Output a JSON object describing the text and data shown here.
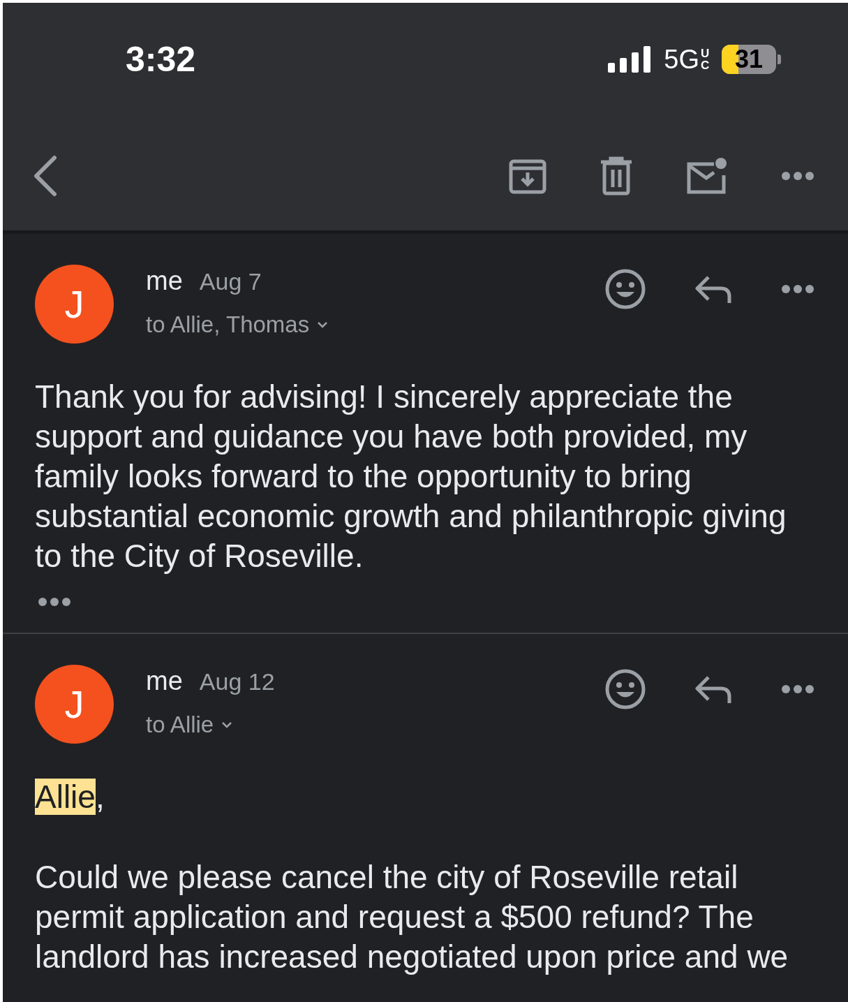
{
  "status_bar": {
    "time": "3:32",
    "network": "5G",
    "network_badge": "UC",
    "battery": "31"
  },
  "messages": [
    {
      "avatar": "J",
      "sender": "me",
      "date": "Aug 7",
      "recipients": "to Allie, Thomas",
      "paragraphs": [
        {
          "text": "Thank you for advising! I sincerely appreciate the support and guidance you have both provided, my family looks forward to the opportunity to bring substantial economic growth and philanthropic giving to the City of Roseville.",
          "highlight": false
        }
      ],
      "trimmed": true
    },
    {
      "avatar": "J",
      "sender": "me",
      "date": "Aug 12",
      "recipients": "to Allie",
      "paragraphs": [
        {
          "text": "Allie",
          "highlight": true,
          "after": ","
        },
        {
          "text": "Could we please cancel the city of Roseville retail permit application and request a $500 refund? The landlord has increased negotiated upon price and we",
          "highlight": false
        }
      ]
    }
  ]
}
